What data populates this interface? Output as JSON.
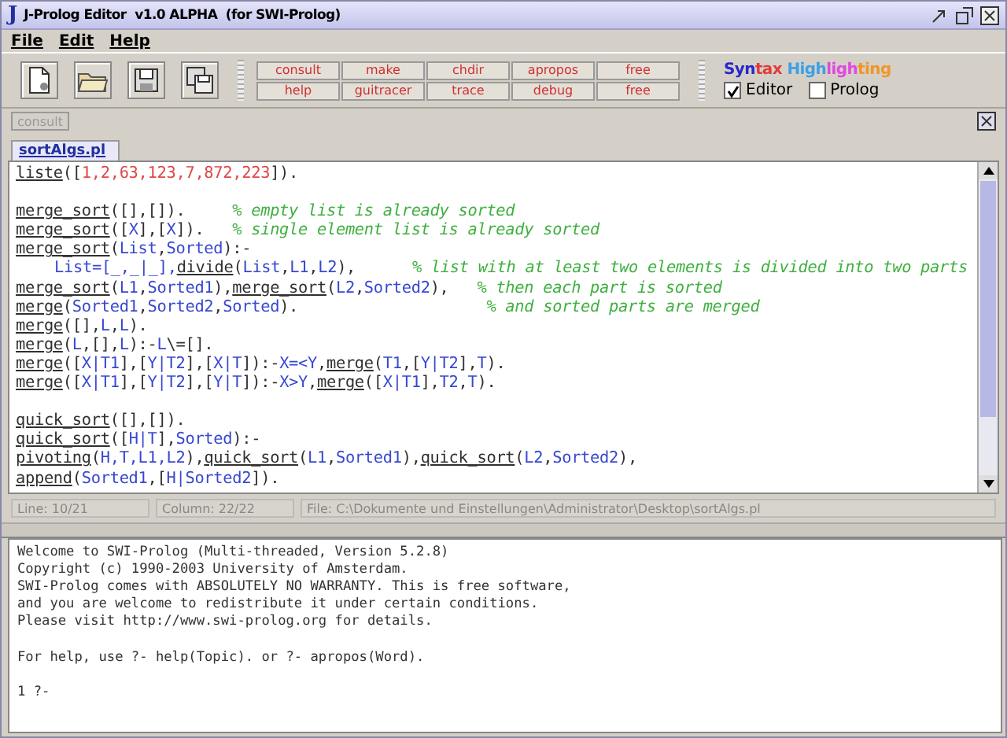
{
  "window": {
    "logo": "J",
    "title": "J-Prolog Editor  v1.0 ALPHA  (for SWI-Prolog)"
  },
  "menu": [
    "File",
    "Edit",
    "Help"
  ],
  "toolbar": {
    "command_buttons": [
      [
        "consult",
        "make",
        "chdir",
        "apropos",
        "free"
      ],
      [
        "help",
        "guitracer",
        "trace",
        "debug",
        "free"
      ]
    ],
    "syntax_highlighting": {
      "title_parts": [
        {
          "text": "Syn",
          "color": "#2828c8"
        },
        {
          "text": "tax ",
          "color": "#e03c3c"
        },
        {
          "text": "High",
          "color": "#3ca0e6"
        },
        {
          "text": "ligh",
          "color": "#e048e0"
        },
        {
          "text": "ting",
          "color": "#f09628"
        }
      ],
      "options": [
        {
          "label": "Editor",
          "checked": true
        },
        {
          "label": "Prolog",
          "checked": false
        }
      ]
    }
  },
  "consult_button": {
    "label": "consult",
    "disabled": true
  },
  "tabs": [
    {
      "label": "sortAlgs.pl",
      "selected": true
    }
  ],
  "editor": {
    "lines": [
      {
        "kind": "code",
        "tokens": [
          {
            "kind": "pred",
            "text": "liste"
          },
          {
            "kind": "plain",
            "text": "(["
          },
          {
            "kind": "num",
            "text": "1,2,63,123,7,872,223"
          },
          {
            "kind": "plain",
            "text": "])."
          }
        ]
      },
      {
        "kind": "blank"
      },
      {
        "kind": "code",
        "tokens": [
          {
            "kind": "pred",
            "text": "merge_sort"
          },
          {
            "kind": "plain",
            "text": "([],[]).     "
          },
          {
            "kind": "comment",
            "text": "% empty list is already sorted"
          }
        ]
      },
      {
        "kind": "code",
        "tokens": [
          {
            "kind": "pred",
            "text": "merge_sort"
          },
          {
            "kind": "plain",
            "text": "(["
          },
          {
            "kind": "var",
            "text": "X"
          },
          {
            "kind": "plain",
            "text": "],["
          },
          {
            "kind": "var",
            "text": "X"
          },
          {
            "kind": "plain",
            "text": "]).   "
          },
          {
            "kind": "comment",
            "text": "% single element list is already sorted"
          }
        ]
      },
      {
        "kind": "code",
        "tokens": [
          {
            "kind": "pred",
            "text": "merge_sort"
          },
          {
            "kind": "plain",
            "text": "("
          },
          {
            "kind": "var",
            "text": "List"
          },
          {
            "kind": "plain",
            "text": ","
          },
          {
            "kind": "var",
            "text": "Sorted"
          },
          {
            "kind": "plain",
            "text": "):-"
          }
        ]
      },
      {
        "kind": "indented",
        "tokens": [
          {
            "kind": "var",
            "text": "List=[_,_|_],"
          },
          {
            "kind": "pred",
            "text": "divide"
          },
          {
            "kind": "plain",
            "text": "("
          },
          {
            "kind": "var",
            "text": "List"
          },
          {
            "kind": "plain",
            "text": ","
          },
          {
            "kind": "var",
            "text": "L1"
          },
          {
            "kind": "plain",
            "text": ","
          },
          {
            "kind": "var",
            "text": "L2"
          },
          {
            "kind": "plain",
            "text": "),      "
          },
          {
            "kind": "comment",
            "text": "% list with at least two elements is divided into two parts"
          }
        ]
      },
      {
        "kind": "code",
        "tokens": [
          {
            "kind": "pred",
            "text": "merge_sort"
          },
          {
            "kind": "plain",
            "text": "("
          },
          {
            "kind": "var",
            "text": "L1"
          },
          {
            "kind": "plain",
            "text": ","
          },
          {
            "kind": "var",
            "text": "Sorted1"
          },
          {
            "kind": "plain",
            "text": "),"
          },
          {
            "kind": "pred",
            "text": "merge_sort"
          },
          {
            "kind": "plain",
            "text": "("
          },
          {
            "kind": "var",
            "text": "L2"
          },
          {
            "kind": "plain",
            "text": ","
          },
          {
            "kind": "var",
            "text": "Sorted2"
          },
          {
            "kind": "plain",
            "text": "),   "
          },
          {
            "kind": "comment",
            "text": "% then each part is sorted"
          }
        ]
      },
      {
        "kind": "code",
        "tokens": [
          {
            "kind": "pred",
            "text": "merge"
          },
          {
            "kind": "plain",
            "text": "("
          },
          {
            "kind": "var",
            "text": "Sorted1"
          },
          {
            "kind": "plain",
            "text": ","
          },
          {
            "kind": "var",
            "text": "Sorted2"
          },
          {
            "kind": "plain",
            "text": ","
          },
          {
            "kind": "var",
            "text": "Sorted"
          },
          {
            "kind": "plain",
            "text": ").                    "
          },
          {
            "kind": "comment",
            "text": "% and sorted parts are merged"
          }
        ]
      },
      {
        "kind": "code",
        "tokens": [
          {
            "kind": "pred",
            "text": "merge"
          },
          {
            "kind": "plain",
            "text": "([],"
          },
          {
            "kind": "var",
            "text": "L"
          },
          {
            "kind": "plain",
            "text": ","
          },
          {
            "kind": "var",
            "text": "L"
          },
          {
            "kind": "plain",
            "text": ")."
          }
        ]
      },
      {
        "kind": "code",
        "tokens": [
          {
            "kind": "pred",
            "text": "merge"
          },
          {
            "kind": "plain",
            "text": "("
          },
          {
            "kind": "var",
            "text": "L"
          },
          {
            "kind": "plain",
            "text": ",[],"
          },
          {
            "kind": "var",
            "text": "L"
          },
          {
            "kind": "plain",
            "text": "):-"
          },
          {
            "kind": "var",
            "text": "L"
          },
          {
            "kind": "plain",
            "text": "\\=[]."
          }
        ]
      },
      {
        "kind": "code",
        "tokens": [
          {
            "kind": "pred",
            "text": "merge"
          },
          {
            "kind": "plain",
            "text": "(["
          },
          {
            "kind": "var",
            "text": "X|T1"
          },
          {
            "kind": "plain",
            "text": "],["
          },
          {
            "kind": "var",
            "text": "Y|T2"
          },
          {
            "kind": "plain",
            "text": "],["
          },
          {
            "kind": "var",
            "text": "X|T"
          },
          {
            "kind": "plain",
            "text": "]):-"
          },
          {
            "kind": "var",
            "text": "X=<Y"
          },
          {
            "kind": "plain",
            "text": ","
          },
          {
            "kind": "pred",
            "text": "merge"
          },
          {
            "kind": "plain",
            "text": "("
          },
          {
            "kind": "var",
            "text": "T1"
          },
          {
            "kind": "plain",
            "text": ",["
          },
          {
            "kind": "var",
            "text": "Y|T2"
          },
          {
            "kind": "plain",
            "text": "],"
          },
          {
            "kind": "var",
            "text": "T"
          },
          {
            "kind": "plain",
            "text": ")."
          }
        ]
      },
      {
        "kind": "code",
        "tokens": [
          {
            "kind": "pred",
            "text": "merge"
          },
          {
            "kind": "plain",
            "text": "(["
          },
          {
            "kind": "var",
            "text": "X|T1"
          },
          {
            "kind": "plain",
            "text": "],["
          },
          {
            "kind": "var",
            "text": "Y|T2"
          },
          {
            "kind": "plain",
            "text": "],["
          },
          {
            "kind": "var",
            "text": "Y|T"
          },
          {
            "kind": "plain",
            "text": "]):-"
          },
          {
            "kind": "var",
            "text": "X>Y"
          },
          {
            "kind": "plain",
            "text": ","
          },
          {
            "kind": "pred",
            "text": "merge"
          },
          {
            "kind": "plain",
            "text": "(["
          },
          {
            "kind": "var",
            "text": "X|T1"
          },
          {
            "kind": "plain",
            "text": "],"
          },
          {
            "kind": "var",
            "text": "T2"
          },
          {
            "kind": "plain",
            "text": ","
          },
          {
            "kind": "var",
            "text": "T"
          },
          {
            "kind": "plain",
            "text": ")."
          }
        ]
      },
      {
        "kind": "blank"
      },
      {
        "kind": "code",
        "tokens": [
          {
            "kind": "pred",
            "text": "quick_sort"
          },
          {
            "kind": "plain",
            "text": "([],[])."
          }
        ]
      },
      {
        "kind": "code",
        "tokens": [
          {
            "kind": "pred",
            "text": "quick_sort"
          },
          {
            "kind": "plain",
            "text": "(["
          },
          {
            "kind": "var",
            "text": "H|T"
          },
          {
            "kind": "plain",
            "text": "],"
          },
          {
            "kind": "var",
            "text": "Sorted"
          },
          {
            "kind": "plain",
            "text": "):-"
          }
        ]
      },
      {
        "kind": "code",
        "tokens": [
          {
            "kind": "pred",
            "text": "pivoting"
          },
          {
            "kind": "plain",
            "text": "("
          },
          {
            "kind": "var",
            "text": "H,T,L1,L2"
          },
          {
            "kind": "plain",
            "text": "),"
          },
          {
            "kind": "pred",
            "text": "quick_sort"
          },
          {
            "kind": "plain",
            "text": "("
          },
          {
            "kind": "var",
            "text": "L1"
          },
          {
            "kind": "plain",
            "text": ","
          },
          {
            "kind": "var",
            "text": "Sorted1"
          },
          {
            "kind": "plain",
            "text": "),"
          },
          {
            "kind": "pred",
            "text": "quick_sort"
          },
          {
            "kind": "plain",
            "text": "("
          },
          {
            "kind": "var",
            "text": "L2"
          },
          {
            "kind": "plain",
            "text": ","
          },
          {
            "kind": "var",
            "text": "Sorted2"
          },
          {
            "kind": "plain",
            "text": "),"
          }
        ]
      },
      {
        "kind": "code",
        "tokens": [
          {
            "kind": "pred",
            "text": "append"
          },
          {
            "kind": "plain",
            "text": "("
          },
          {
            "kind": "var",
            "text": "Sorted1"
          },
          {
            "kind": "plain",
            "text": ",["
          },
          {
            "kind": "var",
            "text": "H|Sorted2"
          },
          {
            "kind": "plain",
            "text": "])."
          }
        ]
      }
    ]
  },
  "status_bar": [
    "Line: 10/21",
    "Column: 22/22",
    "File: C:\\Dokumente und Einstellungen\\Administrator\\Desktop\\sortAlgs.pl"
  ],
  "console": {
    "paragraphs": [
      [
        "Welcome to SWI-Prolog (Multi-threaded, Version 5.2.8)",
        "Copyright (c) 1990-2003 University of Amsterdam.",
        "SWI-Prolog comes with ABSOLUTELY NO WARRANTY. This is free software,",
        "and you are welcome to redistribute it under certain conditions.",
        "Please visit http://www.swi-prolog.org for details."
      ],
      [
        "For help, use ?- help(Topic). or ?- apropos(Word)."
      ],
      [
        "1 ?-"
      ]
    ]
  }
}
